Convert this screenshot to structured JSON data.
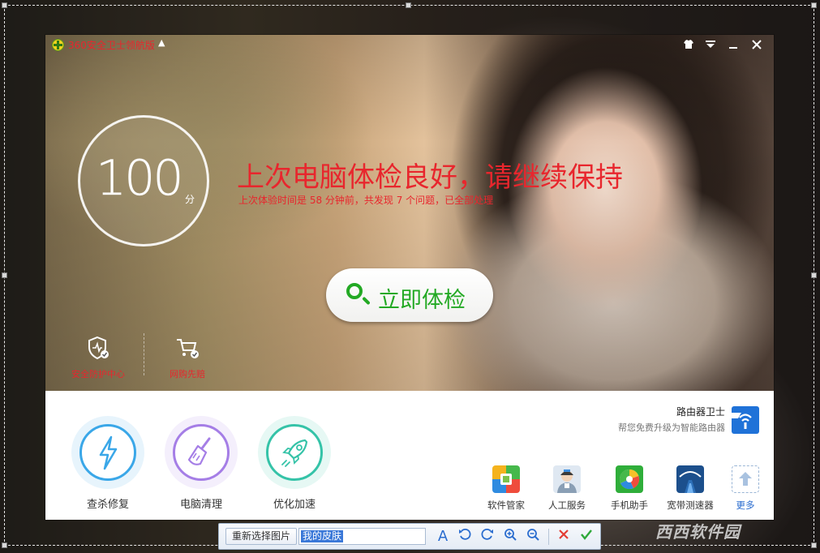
{
  "titlebar": {
    "app_title": "360安全卫士领航版",
    "controls": [
      "shirt-icon",
      "menu-icon",
      "minimize-icon",
      "close-icon"
    ]
  },
  "hero": {
    "score": "100",
    "score_unit": "分",
    "status_title": "上次电脑体检良好，请继续保持",
    "status_detail": "上次体验时间是 58 分钟前，共发现 7 个问题，已全部处理",
    "check_button": "立即体检",
    "tools": [
      {
        "label": "安全防护中心",
        "icon": "shield-icon"
      },
      {
        "label": "网购先赔",
        "icon": "cart-icon"
      }
    ],
    "accent_color": "#e8262d",
    "button_color": "#23a924"
  },
  "panel": {
    "features": [
      {
        "label": "查杀修复",
        "icon": "lightning-icon",
        "color": "#3aa7e8"
      },
      {
        "label": "电脑清理",
        "icon": "broom-icon",
        "color": "#a57ee6"
      },
      {
        "label": "优化加速",
        "icon": "rocket-icon",
        "color": "#35c3a8"
      }
    ],
    "router": {
      "title": "路由器卫士",
      "subtitle": "帮您免费升级为智能路由器"
    },
    "apps": [
      {
        "label": "软件管家",
        "icon": "software-manager-icon"
      },
      {
        "label": "人工服务",
        "icon": "customer-service-icon"
      },
      {
        "label": "手机助手",
        "icon": "phone-assistant-icon"
      },
      {
        "label": "宽带测速器",
        "icon": "speed-test-icon"
      },
      {
        "label": "更多",
        "icon": "more-icon"
      }
    ]
  },
  "capture_toolbar": {
    "reselect_label": "重新选择图片",
    "name_value": "我的皮肤",
    "text_tool": "A",
    "tools": [
      "text-icon",
      "rotate-left-icon",
      "rotate-right-icon",
      "zoom-in-icon",
      "zoom-out-icon",
      "cancel-icon",
      "confirm-icon"
    ]
  },
  "watermark": "西西软件园"
}
